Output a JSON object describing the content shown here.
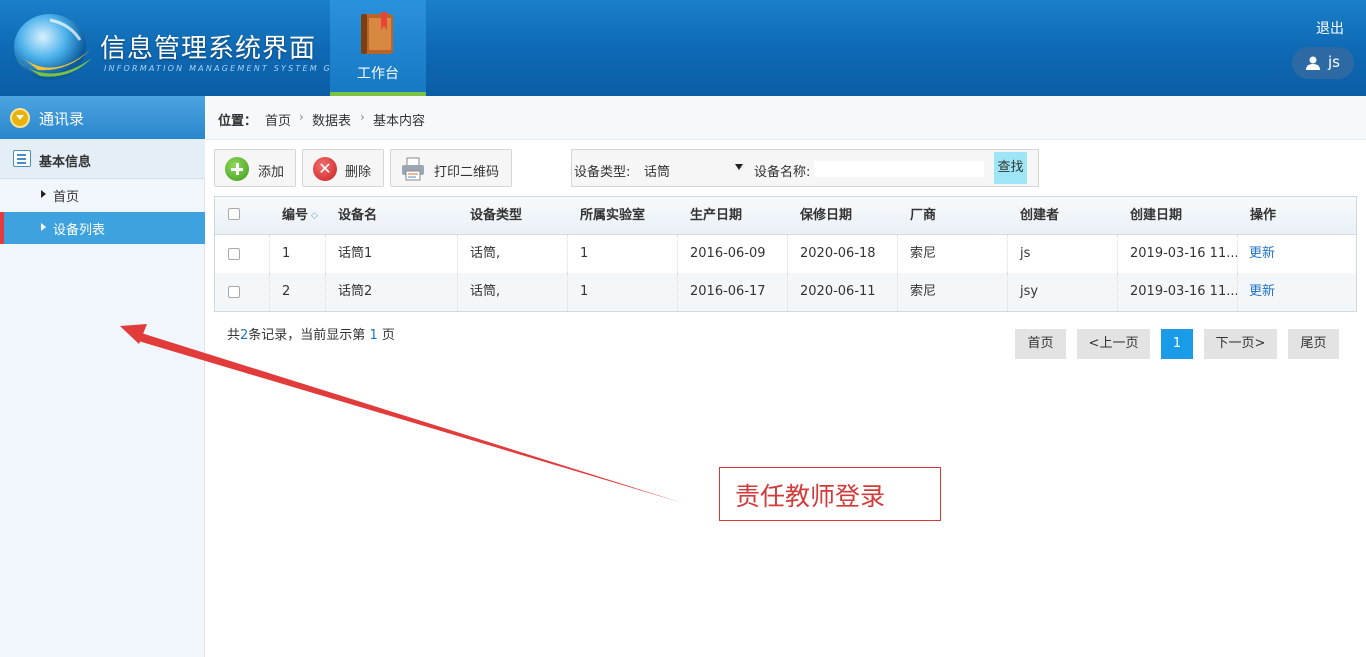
{
  "header": {
    "title": "信息管理系统界面",
    "subtitle": "INFORMATION MANAGEMENT SYSTEM GUI",
    "workbench_label": "工作台",
    "logout": "退出",
    "username": "js"
  },
  "sidebar": {
    "section": "通讯录",
    "group": "基本信息",
    "items": [
      {
        "label": "首页"
      },
      {
        "label": "设备列表"
      }
    ]
  },
  "breadcrumb": {
    "prefix": "位置：",
    "items": [
      "首页",
      "数据表",
      "基本内容"
    ]
  },
  "toolbar": {
    "add": "添加",
    "delete": "删除",
    "print_qr": "打印二维码"
  },
  "search": {
    "type_label": "设备类型:",
    "type_value": "话筒",
    "name_label": "设备名称:",
    "name_value": "",
    "button": "查找"
  },
  "table": {
    "columns": [
      "编号",
      "设备名",
      "设备类型",
      "所属实验室",
      "生产日期",
      "保修日期",
      "厂商",
      "创建者",
      "创建日期",
      "操作"
    ],
    "rows": [
      {
        "id": "1",
        "name": "话筒1",
        "type": "话筒,",
        "lab": "1",
        "produced": "2016-06-09",
        "warranty": "2020-06-18",
        "vendor": "索尼",
        "creator": "js",
        "created": "2019-03-16 11...",
        "action": "更新"
      },
      {
        "id": "2",
        "name": "话筒2",
        "type": "话筒,",
        "lab": "1",
        "produced": "2016-06-17",
        "warranty": "2020-06-11",
        "vendor": "索尼",
        "creator": "jsy",
        "created": "2019-03-16 11...",
        "action": "更新"
      }
    ]
  },
  "pager": {
    "summary_1": "共",
    "total": "2",
    "summary_2": "条记录，当前显示第",
    "current": "1",
    "summary_3": "页",
    "first": "首页",
    "prev": "<上一页",
    "page": "1",
    "next": "下一页>",
    "last": "尾页"
  },
  "annotation": {
    "text": "责任教师登录",
    "color": "#d33a3a"
  },
  "colors": {
    "header_blue": "#0e68b3",
    "accent_blue": "#3ea2df",
    "active_marker": "#e23b3b"
  }
}
